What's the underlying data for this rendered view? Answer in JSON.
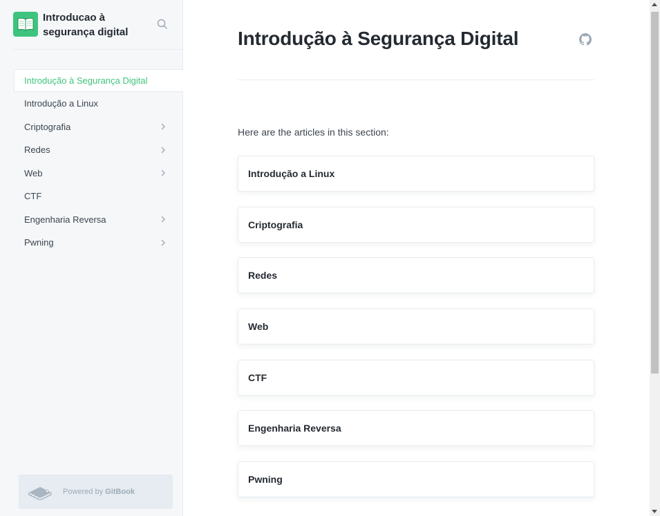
{
  "site": {
    "title": "Introducao à segurança digital"
  },
  "icons": {
    "logo": "open-book-icon",
    "search": "search-icon",
    "github": "github-icon",
    "chevron": "chevron-right-icon",
    "gitbook": "gitbook-icon"
  },
  "colors": {
    "accent": "#3ec47e",
    "sidebar_bg": "#f5f7f9",
    "border": "#e6ecf1",
    "text": "#242a31"
  },
  "sidebar": {
    "items": [
      {
        "label": "Introdução à Segurança Digital",
        "active": true,
        "has_children": false
      },
      {
        "label": "Introdução a Linux",
        "active": false,
        "has_children": false
      },
      {
        "label": "Criptografia",
        "active": false,
        "has_children": true
      },
      {
        "label": "Redes",
        "active": false,
        "has_children": true
      },
      {
        "label": "Web",
        "active": false,
        "has_children": true
      },
      {
        "label": "CTF",
        "active": false,
        "has_children": false
      },
      {
        "label": "Engenharia Reversa",
        "active": false,
        "has_children": true
      },
      {
        "label": "Pwning",
        "active": false,
        "has_children": true
      }
    ],
    "powered": {
      "prefix": "Powered by ",
      "brand": "GitBook"
    }
  },
  "main": {
    "title": "Introdução à Segurança Digital",
    "intro": "Here are the articles in this section:",
    "articles": [
      "Introdução a Linux",
      "Criptografia",
      "Redes",
      "Web",
      "CTF",
      "Engenharia Reversa",
      "Pwning"
    ]
  }
}
